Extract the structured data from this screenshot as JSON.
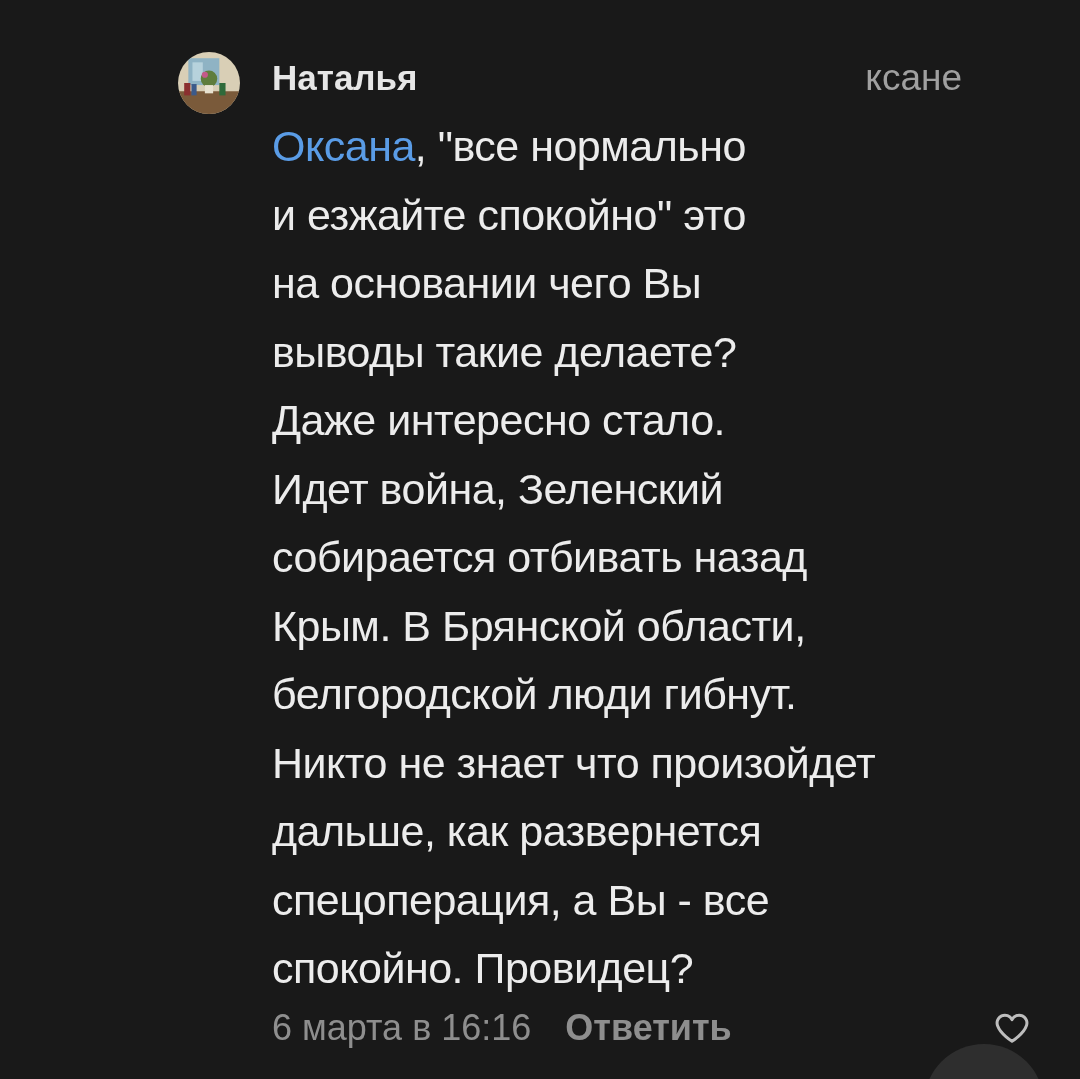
{
  "comment": {
    "author": "Наталья",
    "reply_to": "ксане",
    "mention": "Оксана",
    "lines": [
      ", \"все нормально",
      "и езжайте спокойно\" это",
      "на основании чего Вы",
      "выводы такие делаете?",
      "Даже интересно стало.",
      "Идет война, Зеленский",
      "собирается отбивать назад",
      "Крым. В Брянской области,",
      "белгородской люди гибнут.",
      "Никто не знает что произойдет",
      "дальше, как развернется",
      "спецоперация, а Вы - все",
      "спокойно. Провидец?"
    ],
    "time": "6 марта в 16:16",
    "reply_button": "Ответить",
    "liked": false
  }
}
